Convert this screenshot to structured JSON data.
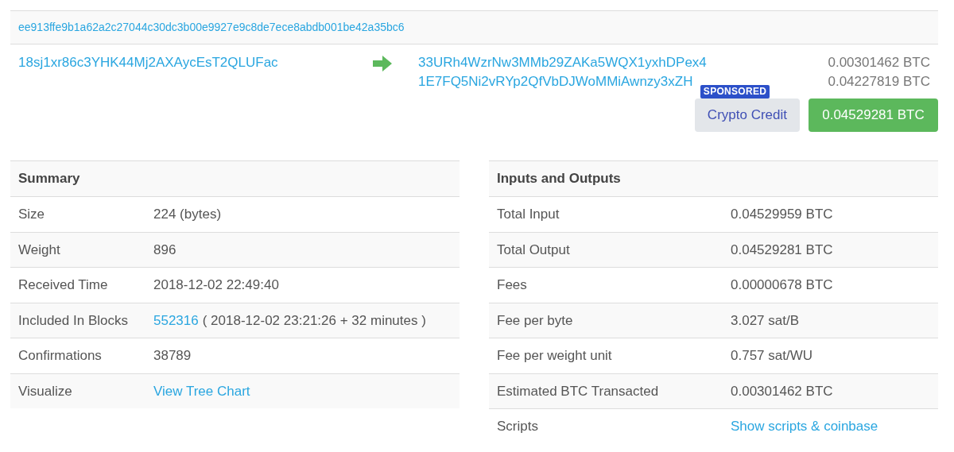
{
  "transaction": {
    "hash": "ee913ffe9b1a62a2c27044c30dc3b00e9927e9c8de7ece8abdb001be42a35bc6",
    "inputs": [
      "18sj1xr86c3YHK44Mj2AXAycEsT2QLUFac"
    ],
    "outputs": [
      {
        "address": "33URh4WzrNw3MMb29ZAKa5WQX1yxhDPex4",
        "amount": "0.00301462 BTC"
      },
      {
        "address": "1E7FQ5Ni2vRYp2QfVbDJWoMMiAwnzy3xZH",
        "amount": "0.04227819 BTC"
      }
    ],
    "sponsored": {
      "badge": "SPONSORED",
      "label": "Crypto Credit"
    },
    "total": "0.04529281 BTC"
  },
  "summary": {
    "title": "Summary",
    "rows": [
      {
        "label": "Size",
        "value": "224 (bytes)"
      },
      {
        "label": "Weight",
        "value": "896"
      },
      {
        "label": "Received Time",
        "value": "2018-12-02 22:49:40"
      },
      {
        "label": "Included In Blocks",
        "link": "552316",
        "value": "( 2018-12-02 23:21:26 + 32 minutes )"
      },
      {
        "label": "Confirmations",
        "value": "38789"
      },
      {
        "label": "Visualize",
        "link": "View Tree Chart"
      }
    ]
  },
  "inputs_outputs": {
    "title": "Inputs and Outputs",
    "rows": [
      {
        "label": "Total Input",
        "value": "0.04529959 BTC"
      },
      {
        "label": "Total Output",
        "value": "0.04529281 BTC"
      },
      {
        "label": "Fees",
        "value": "0.00000678 BTC"
      },
      {
        "label": "Fee per byte",
        "value": "3.027 sat/B"
      },
      {
        "label": "Fee per weight unit",
        "value": "0.757 sat/WU"
      },
      {
        "label": "Estimated BTC Transacted",
        "value": "0.00301462 BTC"
      },
      {
        "label": "Scripts",
        "link": "Show scripts & coinbase"
      }
    ]
  }
}
